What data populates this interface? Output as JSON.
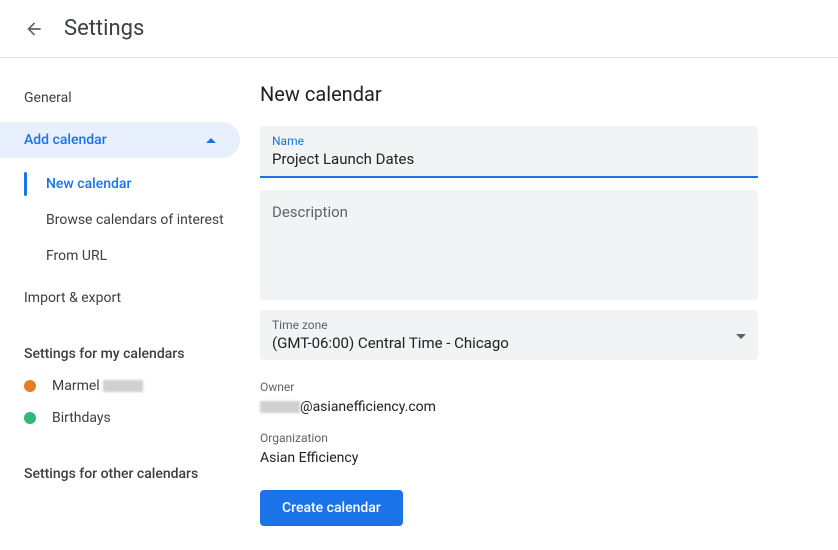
{
  "header": {
    "title": "Settings"
  },
  "sidebar": {
    "general": "General",
    "add_calendar": "Add calendar",
    "subitems": {
      "new_calendar": "New calendar",
      "browse": "Browse calendars of interest",
      "from_url": "From URL"
    },
    "import_export": "Import & export",
    "my_calendars_title": "Settings for my calendars",
    "calendars": [
      {
        "name": "Marmel",
        "color": "#e67c26"
      },
      {
        "name": "Birthdays",
        "color": "#33b679"
      }
    ],
    "other_calendars_title": "Settings for other calendars"
  },
  "main": {
    "title": "New calendar",
    "name_label": "Name",
    "name_value": "Project Launch Dates",
    "description_label": "Description",
    "timezone_label": "Time zone",
    "timezone_value": "(GMT-06:00) Central Time - Chicago",
    "owner_label": "Owner",
    "owner_value_suffix": "@asianefficiency.com",
    "org_label": "Organization",
    "org_value": "Asian Efficiency",
    "create_button": "Create calendar"
  }
}
